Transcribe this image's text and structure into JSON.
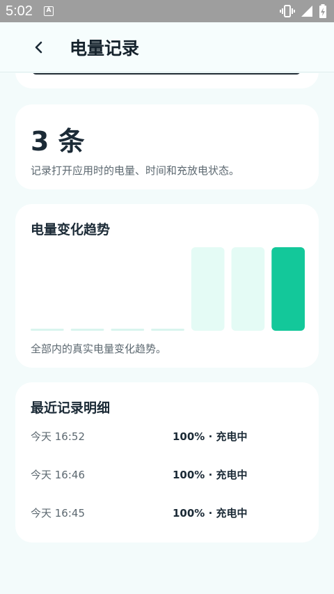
{
  "status_bar": {
    "time": "5:02",
    "notification_glyph": "A",
    "icons": [
      "vibrate-icon",
      "signal-icon",
      "battery-charging-icon"
    ]
  },
  "header": {
    "title": "电量记录",
    "back_icon": "chevron-left-icon"
  },
  "summary": {
    "count": "3 条",
    "description": "记录打开应用时的电量、时间和充放电状态。"
  },
  "trend": {
    "title": "电量变化趋势",
    "caption": "全部内的真实电量变化趋势。"
  },
  "chart_data": {
    "type": "bar",
    "values": [
      0,
      0,
      0,
      0,
      100,
      100,
      100
    ],
    "ylim": [
      0,
      100
    ],
    "highlight_index": 6,
    "colors": {
      "empty": "#d9f5ee",
      "normal": "#e4fbf5",
      "highlight": "#13c89a"
    }
  },
  "records": {
    "title": "最近记录明细",
    "items": [
      {
        "time": "今天 16:52",
        "status": "100% · 充电中"
      },
      {
        "time": "今天 16:46",
        "status": "100% · 充电中"
      },
      {
        "time": "今天 16:45",
        "status": "100% · 充电中"
      }
    ]
  }
}
